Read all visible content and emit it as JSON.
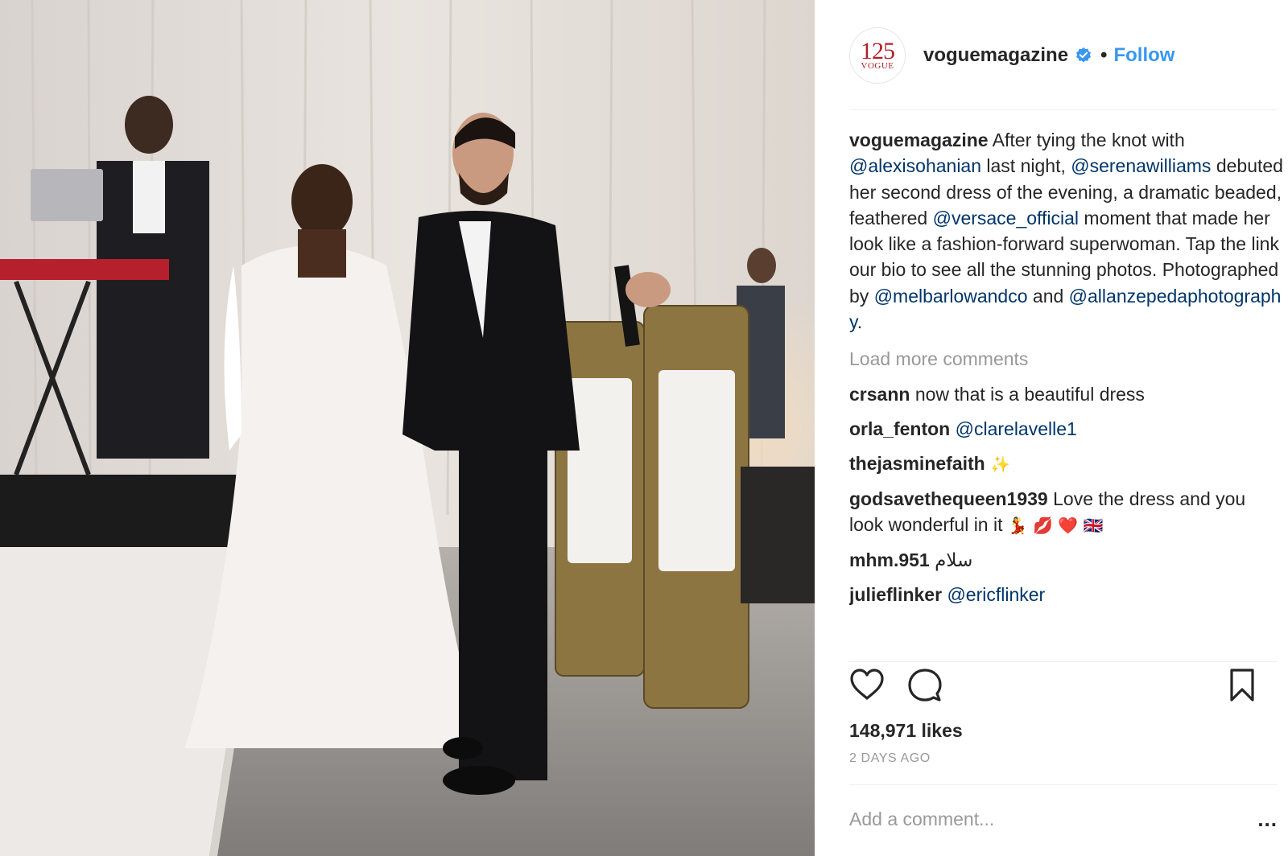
{
  "post": {
    "photo_alt": "Wedding reception photo",
    "header": {
      "avatar": {
        "number": "125",
        "brand": "VOGUE"
      },
      "username": "voguemagazine",
      "verified_icon": "verified-badge-icon",
      "separator": "•",
      "follow_label": "Follow"
    },
    "caption": {
      "username": "voguemagazine",
      "t1": " After tying the knot with ",
      "m1": "@alexisohanian",
      "t2": " last night, ",
      "m2": "@serenawilliams",
      "t3": " debuted her second dress of the evening, a dramatic beaded, feathered ",
      "m3": "@versace_official",
      "t4": " moment that made her look like a fashion-forward superwoman. Tap the link our bio to see all the stunning photos. Photographed by ",
      "m4": "@melbarlowandco",
      "t5": " and ",
      "m5": "@allanzepedaphotography",
      "t6": "."
    },
    "load_more_label": "Load more comments",
    "comments": [
      {
        "username": "crsann",
        "text": "now that is a beautiful dress",
        "mention": "",
        "emoji": ""
      },
      {
        "username": "orla_fenton",
        "text": "",
        "mention": "@clarelavelle1",
        "emoji": ""
      },
      {
        "username": "thejasminefaith",
        "text": "",
        "mention": "",
        "emoji": "✨"
      },
      {
        "username": "godsavethequeen1939",
        "text": "Love the dress and you look wonderful in it",
        "mention": "",
        "emoji": "💃 💋 ❤️ 🇬🇧"
      },
      {
        "username": "mhm.951",
        "text": "سلام",
        "mention": "",
        "emoji": ""
      },
      {
        "username": "julieflinker",
        "text": "",
        "mention": "@ericflinker",
        "emoji": ""
      }
    ],
    "actions": {
      "like_icon": "heart-icon",
      "comment_icon": "comment-bubble-icon",
      "save_icon": "bookmark-icon"
    },
    "likes": "148,971 likes",
    "time_ago": "2 DAYS AGO",
    "add_comment_placeholder": "Add a comment...",
    "more_options_label": "..."
  },
  "colors": {
    "link_blue": "#3897f0",
    "mention_navy": "#003569",
    "muted_gray": "#999999",
    "text": "#262626",
    "logo_red": "#b0202a"
  }
}
